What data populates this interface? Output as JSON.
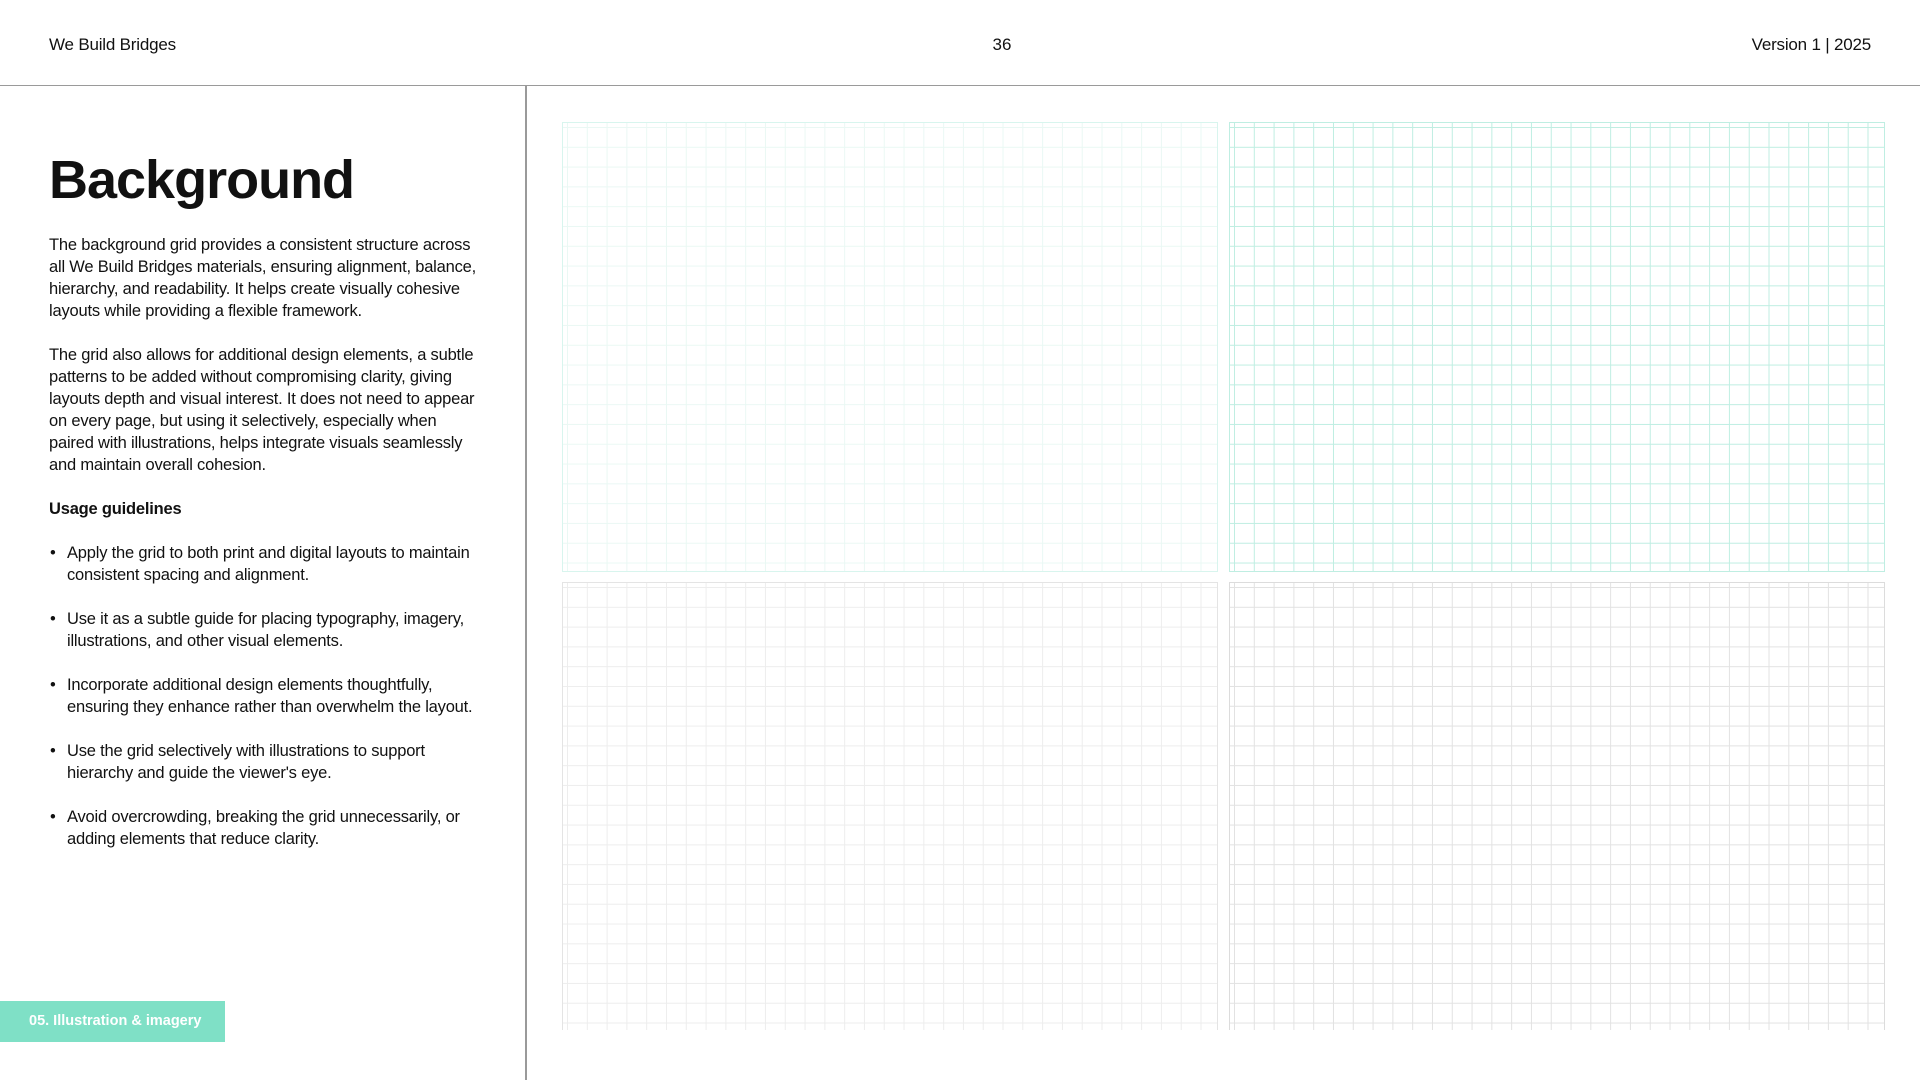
{
  "header": {
    "brand": "We Build Bridges",
    "page_number": "36",
    "version": "Version 1 | 2025"
  },
  "content": {
    "title": "Background",
    "paragraphs": [
      "The background grid provides a consistent structure across all We Build Bridges materials, ensuring alignment, balance, hierarchy, and readability. It helps create visually cohesive layouts while providing a flexible framework.",
      "The grid also allows for additional design elements, a subtle patterns to be added without compromising clarity, giving layouts depth and visual interest. It does not need to appear on every page, but using it selectively, especially when paired with illustrations, helps integrate visuals seamlessly and maintain overall cohesion."
    ],
    "guidelines_heading": "Usage guidelines",
    "bullet_symbol": "•",
    "guidelines": [
      "Apply the grid to both print and digital layouts to maintain consistent spacing and alignment.",
      "Use it as a subtle guide for placing typography, imagery, illustrations, and other visual elements.",
      "Incorporate additional design elements thoughtfully, ensuring they enhance rather than overwhelm the layout.",
      "Use the grid selectively with illustrations to support hierarchy and guide the viewer's eye.",
      "Avoid overcrowding, breaking the grid unnecessarily, or adding elements that reduce clarity."
    ]
  },
  "section_tag": "05. Illustration & imagery",
  "colors": {
    "accent": "#7fe0c6",
    "grid_mint_light": "#eaf8f4",
    "grid_mint": "#bfeee2",
    "grid_gray_light": "#ededed",
    "grid_gray": "#e2e2e2"
  }
}
